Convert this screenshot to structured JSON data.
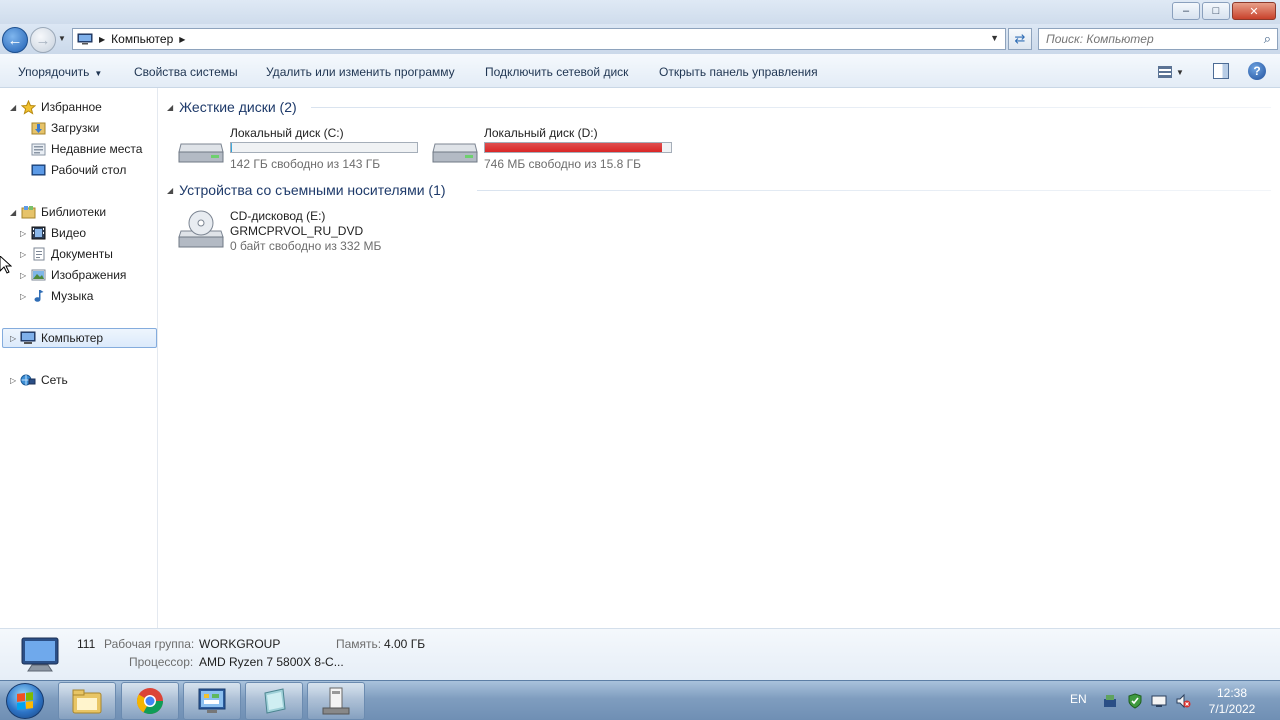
{
  "window": {
    "minimize_label": "–",
    "maximize_label": "□",
    "close_label": "✕"
  },
  "address": {
    "crumb": "Компьютер",
    "search_placeholder": "Поиск: Компьютер"
  },
  "toolbar": {
    "organize": "Упорядочить",
    "system_properties": "Свойства системы",
    "uninstall": "Удалить или изменить программу",
    "map_drive": "Подключить сетевой диск",
    "control_panel": "Открыть панель управления"
  },
  "nav": {
    "favorites": "Избранное",
    "downloads": "Загрузки",
    "recent": "Недавние места",
    "desktop": "Рабочий стол",
    "libraries": "Библиотеки",
    "video": "Видео",
    "documents": "Документы",
    "pictures": "Изображения",
    "music": "Музыка",
    "computer": "Компьютер",
    "network": "Сеть"
  },
  "content": {
    "hard_disks_header": "Жесткие диски (2)",
    "removable_header": "Устройства со съемными носителями (1)",
    "drive_c": {
      "name": "Локальный диск (C:)",
      "free": "142 ГБ свободно из 143 ГБ",
      "used_fraction": 0.007,
      "bar_color": "#26a0da"
    },
    "drive_d": {
      "name": "Локальный диск (D:)",
      "free": "746 МБ свободно из 15.8 ГБ",
      "used_fraction": 0.954,
      "bar_color": "#da2626"
    },
    "drive_e": {
      "name": "CD-дисковод (E:)",
      "label": "GRMCPRVOL_RU_DVD",
      "free": "0 байт свободно из 332 МБ"
    }
  },
  "details": {
    "computer_name": "111",
    "workgroup_label": "Рабочая группа:",
    "workgroup_value": "WORKGROUP",
    "memory_label": "Память:",
    "memory_value": "4.00 ГБ",
    "processor_label": "Процессор:",
    "processor_value": "AMD Ryzen 7 5800X 8-C..."
  },
  "taskbar": {
    "language": "EN",
    "time": "12:38",
    "date": "7/1/2022"
  },
  "icons": {
    "back": "back-arrow-icon",
    "forward": "forward-arrow-icon",
    "refresh": "refresh-icon",
    "search": "search-icon",
    "help": "help-icon"
  }
}
